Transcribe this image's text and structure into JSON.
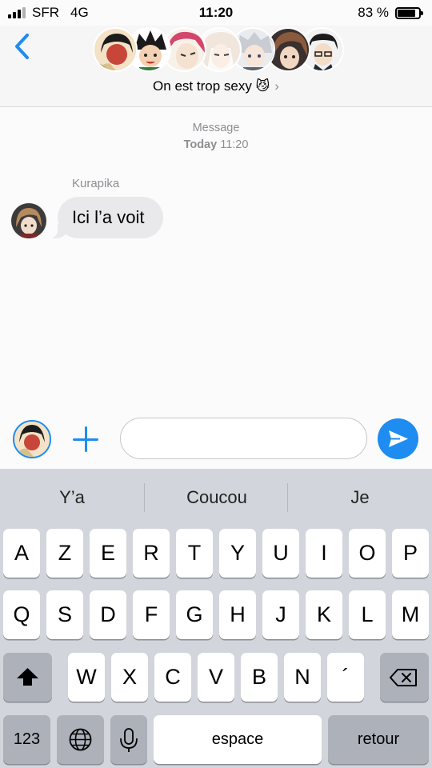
{
  "status_bar": {
    "carrier": "SFR",
    "network": "4G",
    "time": "11:20",
    "battery": "83 %",
    "battery_level": 0.83
  },
  "header": {
    "group_name": "On est trop sexy 😼",
    "chevron": "›",
    "back_icon": "chevron-left-icon",
    "participant_count": 7
  },
  "conversation": {
    "service_label": "Message",
    "date_label": "Today",
    "time_label": "11:20",
    "messages": [
      {
        "sender": "Kurapika",
        "text": "Ici l’a voit"
      }
    ]
  },
  "compose": {
    "placeholder": "",
    "add_icon": "plus-icon",
    "send_icon": "send-arrow-icon"
  },
  "keyboard": {
    "suggestions": [
      "Y’a",
      "Coucou",
      "Je"
    ],
    "row1": [
      "A",
      "Z",
      "E",
      "R",
      "T",
      "Y",
      "U",
      "I",
      "O",
      "P"
    ],
    "row2": [
      "Q",
      "S",
      "D",
      "F",
      "G",
      "H",
      "J",
      "K",
      "L",
      "M"
    ],
    "row3": [
      "W",
      "X",
      "C",
      "V",
      "B",
      "N",
      "´"
    ],
    "numbers_key": "123",
    "space_key": "espace",
    "return_key": "retour",
    "shift_icon": "shift-icon",
    "delete_icon": "delete-icon",
    "globe_icon": "globe-icon",
    "mic_icon": "microphone-icon"
  },
  "colors": {
    "accent": "#1e8cf0",
    "incoming_bubble": "#e9e9eb",
    "keyboard_bg": "#d2d5db",
    "key_dark": "#acb1ba"
  }
}
